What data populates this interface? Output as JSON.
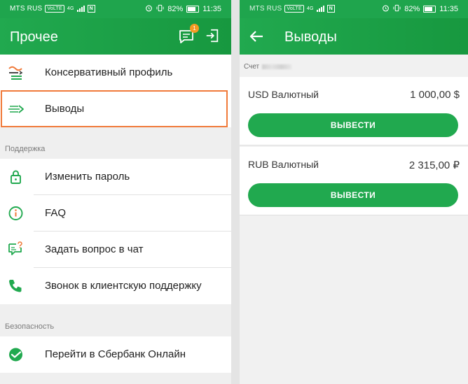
{
  "status_bar": {
    "carrier": "MTS RUS",
    "volte": "VoLTE",
    "network": "4G",
    "nfc": "N",
    "battery": "82%",
    "time": "11:35"
  },
  "left": {
    "title": "Прочее",
    "chat_badge": "1",
    "items_top": [
      {
        "label": "Консервативный профиль",
        "icon": "conservative-profile-icon"
      },
      {
        "label": "Выводы",
        "icon": "withdrawal-arrows-icon"
      }
    ],
    "support_section": "Поддержка",
    "support_items": [
      {
        "label": "Изменить пароль",
        "icon": "lock-icon"
      },
      {
        "label": "FAQ",
        "icon": "info-icon"
      },
      {
        "label": "Задать вопрос в чат",
        "icon": "chat-question-icon"
      },
      {
        "label": "Звонок в клиентскую поддержку",
        "icon": "phone-icon"
      }
    ],
    "security_section": "Безопасность",
    "security_items": [
      {
        "label": "Перейти в Сбербанк Онлайн",
        "icon": "sberbank-logo-icon"
      }
    ]
  },
  "right": {
    "title": "Выводы",
    "account_label": "Счет",
    "accounts": [
      {
        "name": "USD Валютный",
        "amount": "1 000,00 $",
        "button": "ВЫВЕСТИ"
      },
      {
        "name": "RUB Валютный",
        "amount": "2 315,00 ₽",
        "button": "ВЫВЕСТИ"
      }
    ]
  },
  "colors": {
    "brand_green": "#21a94f",
    "highlight_orange": "#f07a3a",
    "badge_orange": "#f39a23"
  }
}
